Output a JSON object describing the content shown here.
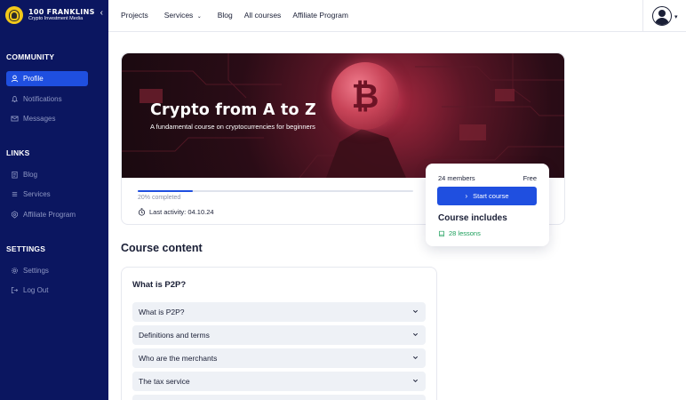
{
  "brand": {
    "name": "100 FRANKLINS",
    "tagline": "Crypto Investment Media"
  },
  "sidebar": {
    "community_title": "COMMUNITY",
    "community_items": [
      {
        "label": "Profile",
        "icon": "user-icon",
        "active": true
      },
      {
        "label": "Notifications",
        "icon": "bell-icon"
      },
      {
        "label": "Messages",
        "icon": "mail-icon"
      }
    ],
    "links_title": "LINKS",
    "links_items": [
      {
        "label": "Blog",
        "icon": "clipboard-icon"
      },
      {
        "label": "Services",
        "icon": "list-icon"
      },
      {
        "label": "Affiliate Program",
        "icon": "badge-icon"
      }
    ],
    "settings_title": "SETTINGS",
    "settings_items": [
      {
        "label": "Settings",
        "icon": "gear-icon"
      },
      {
        "label": "Log Out",
        "icon": "logout-icon"
      }
    ]
  },
  "header": {
    "menu": [
      {
        "label": "Projects"
      },
      {
        "label": "Services",
        "dropdown": true
      },
      {
        "label": "Blog"
      },
      {
        "label": "All courses"
      },
      {
        "label": "Affiliate Program"
      }
    ]
  },
  "course": {
    "title": "Crypto from A to Z",
    "subtitle": "A fundamental course on cryptocurrencies for beginners",
    "progress": 0.2,
    "progress_label": "20% completed",
    "last_activity": "Last activity: 04.10.24",
    "members": "24 members",
    "price": "Free",
    "start_label": "Start course",
    "includes_title": "Course includes",
    "lessons_label": "28 lessons"
  },
  "content": {
    "title": "Course content",
    "module_title": "What is P2P?",
    "lessons": [
      "What is P2P?",
      "Definitions and terms",
      "Who are the merchants",
      "The tax service",
      ""
    ]
  },
  "colors": {
    "sidebar": "#0b1660",
    "accent": "#1f4fe0",
    "success": "#1a9e5a"
  }
}
